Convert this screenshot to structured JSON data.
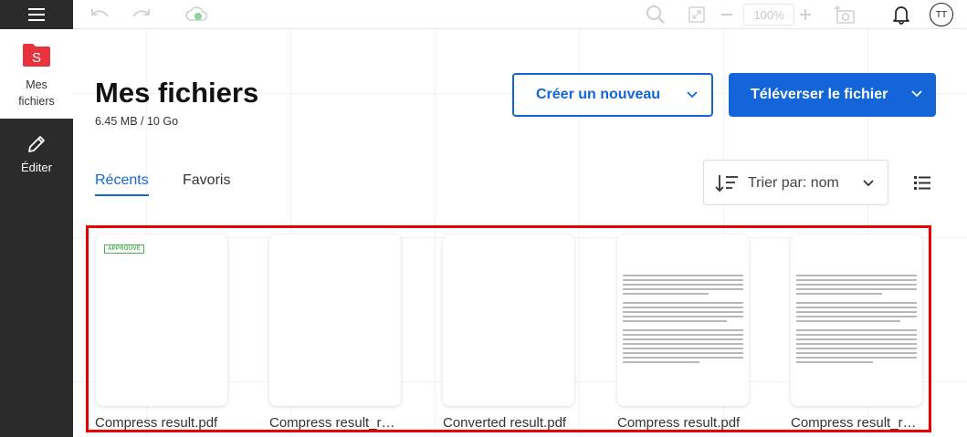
{
  "sidebar": {
    "files_label_line1": "Mes",
    "files_label_line2": "fichiers",
    "files_logo_letter": "S",
    "edit_label": "Éditer"
  },
  "toolbar": {
    "zoom": "100%",
    "avatar_initials": "TT"
  },
  "main": {
    "title": "Mes fichiers",
    "usage": "6.45 MB / 10 Go",
    "create_button": "Créer un nouveau",
    "upload_button": "Téléverser le fichier",
    "tabs": [
      {
        "label": "Récents",
        "active": true
      },
      {
        "label": "Favoris",
        "active": false
      }
    ],
    "sort_label": "Trier par: nom"
  },
  "files": [
    {
      "name": "Compress result.pdf",
      "badge": "APPROUVÉ",
      "has_text": false
    },
    {
      "name": "Compress result_r…",
      "badge": "",
      "has_text": false
    },
    {
      "name": "Converted result.pdf",
      "badge": "",
      "has_text": false
    },
    {
      "name": "Compress result.pdf",
      "badge": "",
      "has_text": true
    },
    {
      "name": "Compress result_r…",
      "badge": "",
      "has_text": true
    }
  ],
  "colors": {
    "accent": "#1466d8",
    "sidebar_bg": "#2b2b2b",
    "logo_red": "#e8333f",
    "highlight": "#e60000",
    "badge_green": "#4caf50"
  }
}
